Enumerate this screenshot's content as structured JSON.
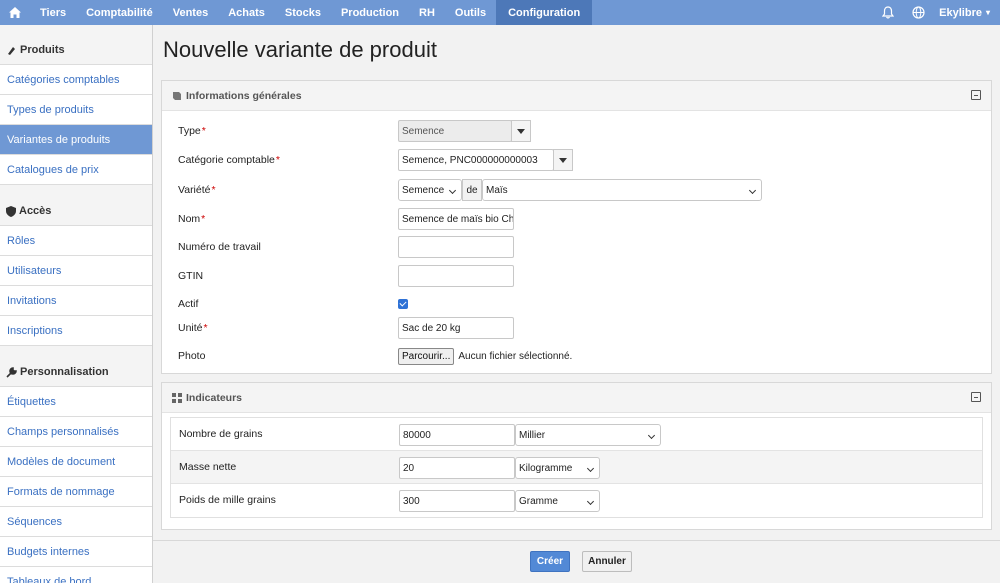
{
  "nav": {
    "items": [
      "Tiers",
      "Comptabilité",
      "Ventes",
      "Achats",
      "Stocks",
      "Production",
      "RH",
      "Outils",
      "Configuration"
    ],
    "active": "Configuration",
    "user": "Ekylibre",
    "accent": "#6f98d4",
    "active_bg": "#4d78b8"
  },
  "sidebar": {
    "sections": [
      {
        "title": "Produits",
        "icon": "flask-icon",
        "items": [
          "Catégories comptables",
          "Types de produits",
          "Variantes de produits",
          "Catalogues de prix"
        ]
      },
      {
        "title": "Accès",
        "icon": "shield-icon",
        "items": [
          "Rôles",
          "Utilisateurs",
          "Invitations",
          "Inscriptions"
        ]
      },
      {
        "title": "Personnalisation",
        "icon": "wrench-icon",
        "items": [
          "Étiquettes",
          "Champs personnalisés",
          "Modèles de document",
          "Formats de nommage",
          "Séquences",
          "Budgets internes",
          "Tableaux de bord"
        ]
      }
    ],
    "active_item": "Variantes de produits"
  },
  "page": {
    "title": "Nouvelle variante de produit"
  },
  "general": {
    "title": "Informations générales",
    "type": {
      "label": "Type",
      "value": "Semence"
    },
    "categorie": {
      "label": "Catégorie comptable",
      "value": "Semence, PNC000000000003"
    },
    "variete": {
      "label": "Variété",
      "value": "Semence",
      "connector": "de",
      "value2": "Maïs"
    },
    "nom": {
      "label": "Nom",
      "value": "Semence de maïs bio Chap"
    },
    "numero": {
      "label": "Numéro de travail",
      "value": ""
    },
    "gtin": {
      "label": "GTIN",
      "value": ""
    },
    "actif": {
      "label": "Actif",
      "checked": true
    },
    "unite": {
      "label": "Unité",
      "value": "Sac de 20 kg"
    },
    "photo": {
      "label": "Photo",
      "button": "Parcourir...",
      "status": "Aucun fichier sélectionné."
    },
    "required_mark": "*"
  },
  "indicators": {
    "title": "Indicateurs",
    "rows": [
      {
        "label": "Nombre de grains",
        "value": "80000",
        "unit": "Millier"
      },
      {
        "label": "Masse nette",
        "value": "20",
        "unit": "Kilogramme"
      },
      {
        "label": "Poids de mille grains",
        "value": "300",
        "unit": "Gramme"
      }
    ]
  },
  "actions": {
    "create": "Créer",
    "cancel": "Annuler"
  }
}
